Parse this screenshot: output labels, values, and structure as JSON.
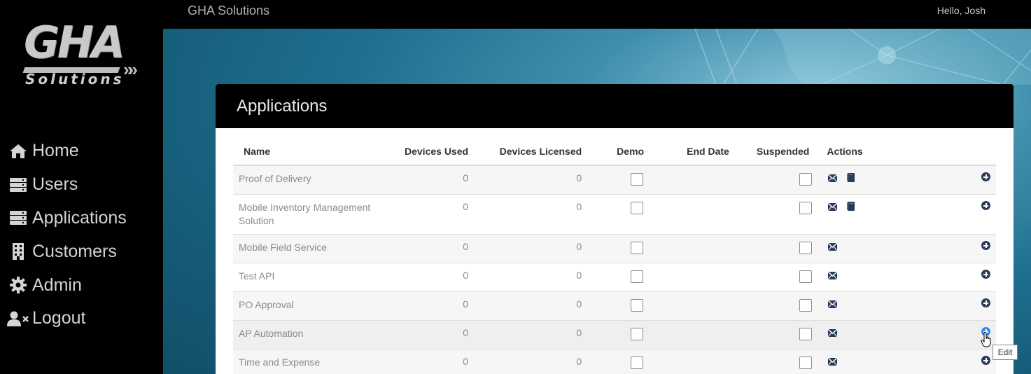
{
  "topbar": {
    "brand": "GHA Solutions",
    "greeting": "Hello, Josh"
  },
  "logo": {
    "top": "GHA",
    "bottom": "Solutions"
  },
  "sidebar": {
    "items": [
      {
        "label": "Home",
        "icon": "home-icon"
      },
      {
        "label": "Users",
        "icon": "server-icon"
      },
      {
        "label": "Applications",
        "icon": "server-icon"
      },
      {
        "label": "Customers",
        "icon": "building-icon"
      },
      {
        "label": "Admin",
        "icon": "gear-icon"
      },
      {
        "label": "Logout",
        "icon": "user-times-icon"
      }
    ]
  },
  "panel": {
    "title": "Applications"
  },
  "table": {
    "columns": [
      "Name",
      "Devices Used",
      "Devices Licensed",
      "Demo",
      "End Date",
      "Suspended",
      "Actions"
    ],
    "rows": [
      {
        "name": "Proof of Delivery",
        "used": "0",
        "licensed": "0",
        "has_book": true
      },
      {
        "name": "Mobile Inventory Management Solution",
        "used": "0",
        "licensed": "0",
        "has_book": true
      },
      {
        "name": "Mobile Field Service",
        "used": "0",
        "licensed": "0",
        "has_book": false
      },
      {
        "name": "Test API",
        "used": "0",
        "licensed": "0",
        "has_book": false
      },
      {
        "name": "PO Approval",
        "used": "0",
        "licensed": "0",
        "has_book": false
      },
      {
        "name": "AP Automation",
        "used": "0",
        "licensed": "0",
        "has_book": false
      },
      {
        "name": "Time and Expense",
        "used": "0",
        "licensed": "0",
        "has_book": false
      }
    ]
  },
  "tooltip": "Edit",
  "colors": {
    "accent": "#2d8cf0",
    "icon": "#2a3b5a",
    "sidebar_text": "#d4d4d4"
  }
}
